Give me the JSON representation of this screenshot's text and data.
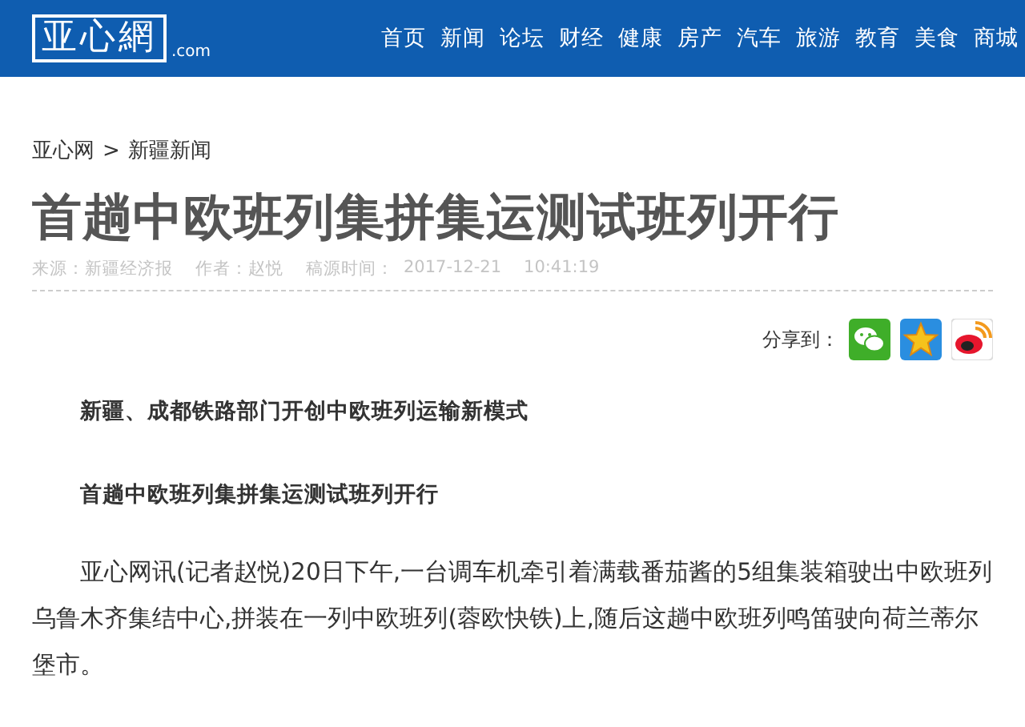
{
  "header": {
    "logo": {
      "name": "亚心網",
      "suffix": ".com"
    },
    "nav": [
      "首页",
      "新闻",
      "论坛",
      "财经",
      "健康",
      "房产",
      "汽车",
      "旅游",
      "教育",
      "美食",
      "商城"
    ]
  },
  "breadcrumb": [
    "亚心网",
    "新疆新闻"
  ],
  "breadcrumb_separator": ">",
  "article": {
    "title": "首趟中欧班列集拼集运测试班列开行",
    "meta": [
      "来源：新疆经济报",
      "作者：赵悦",
      "稿源时间：",
      "2017-12-21",
      "10:41:19"
    ],
    "share_label": "分享到：",
    "share": [
      {
        "kind": "wechat"
      },
      {
        "kind": "qzone"
      },
      {
        "kind": "weibo"
      }
    ],
    "body": [
      {
        "kind": "heading",
        "text": "新疆、成都铁路部门开创中欧班列运输新模式"
      },
      {
        "kind": "heading",
        "text": "首趟中欧班列集拼集运测试班列开行"
      },
      {
        "kind": "paragraph",
        "text": "亚心网讯(记者赵悦)20日下午,一台调车机牵引着满载番茄酱的5组集装箱驶出中欧班列乌鲁木齐集结中心,拼装在一列中欧班列(蓉欧快铁)上,随后这趟中欧班列鸣笛驶向荷兰蒂尔堡市。"
      }
    ]
  }
}
